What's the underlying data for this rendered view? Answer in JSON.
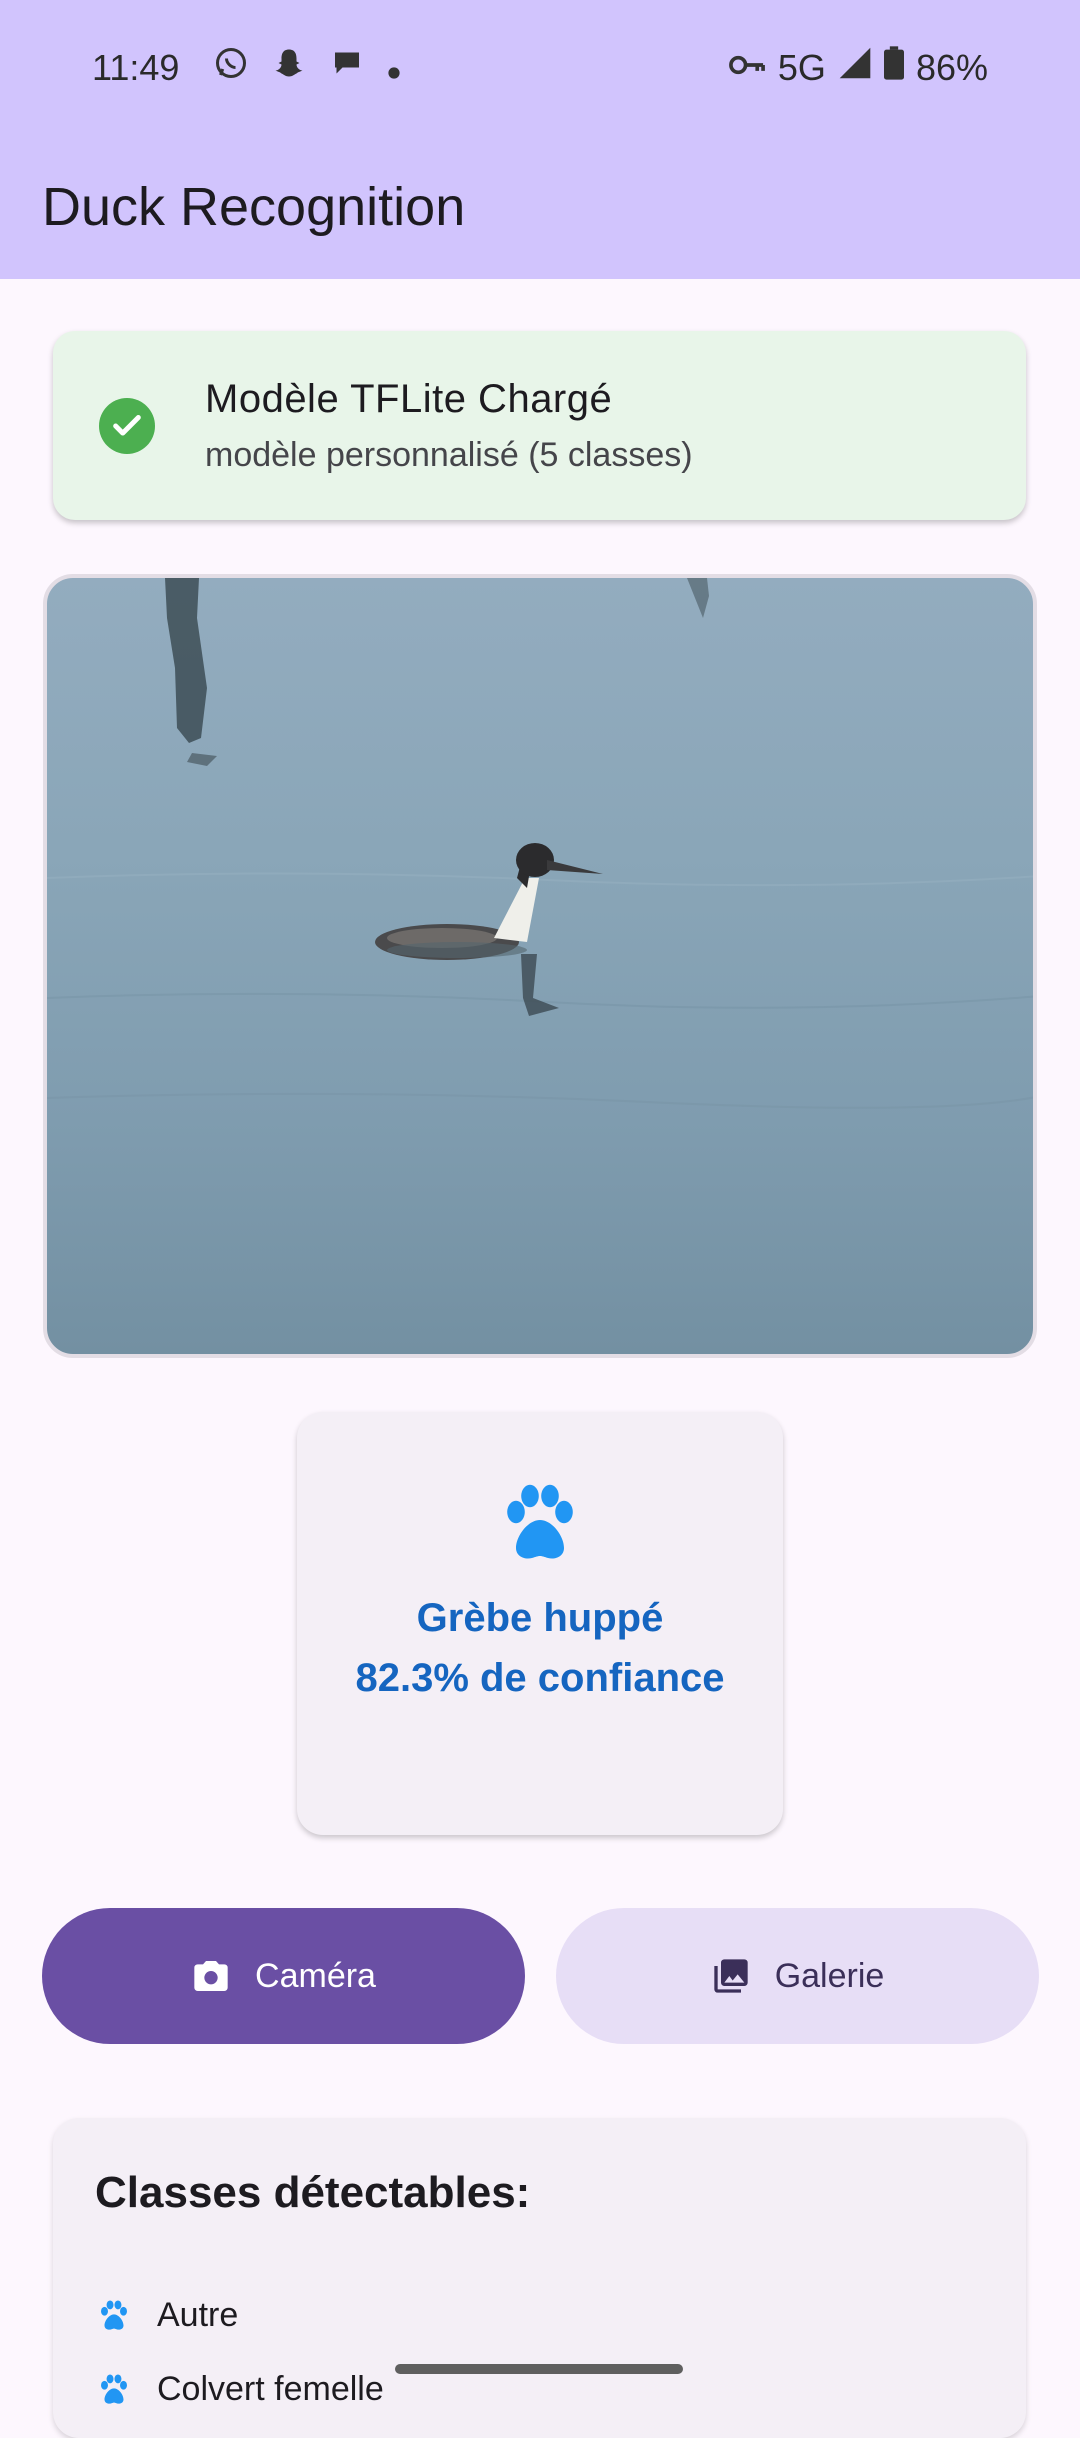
{
  "status_bar": {
    "time": "11:49",
    "notif_icons": [
      "whatsapp-icon",
      "snapchat-icon",
      "chat-bubble-icon",
      "dot-icon"
    ],
    "network": "5G",
    "battery": "86%"
  },
  "app_bar": {
    "title": "Duck Recognition"
  },
  "model_status": {
    "title": "Modèle TFLite Chargé",
    "subtitle": "modèle personnalisé (5 classes)",
    "icon": "check-circle-icon",
    "accent": "#4caf50"
  },
  "result": {
    "icon": "paw-icon",
    "species": "Grèbe huppé",
    "confidence": "82.3% de confiance",
    "color": "#1565c0"
  },
  "actions": {
    "camera_label": "Caméra",
    "gallery_label": "Galerie"
  },
  "classes": {
    "title": "Classes détectables:",
    "items": [
      "Autre",
      "Colvert femelle"
    ]
  },
  "colors": {
    "app_bar": "#d1c4fd",
    "primary_button": "#6a4fa4",
    "secondary_button": "#e7def6"
  }
}
